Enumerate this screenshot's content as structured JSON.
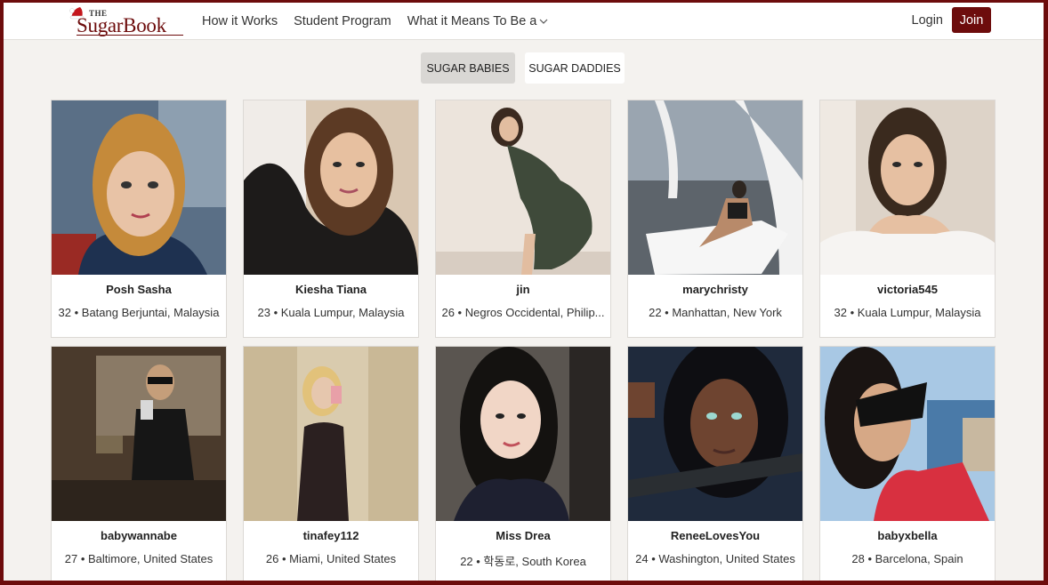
{
  "header": {
    "logo_top": "THE",
    "logo_word": "SugarBook",
    "nav": [
      "How it Works",
      "Student Program",
      "What it Means To Be a"
    ],
    "login": "Login",
    "join": "Join"
  },
  "tabs": [
    "SUGAR BABIES",
    "SUGAR DADDIES"
  ],
  "profiles": [
    {
      "name": "Posh Sasha",
      "info": "32 • Batang Berjuntai, Malaysia"
    },
    {
      "name": "Kiesha Tiana",
      "info": "23 • Kuala Lumpur, Malaysia"
    },
    {
      "name": "jin",
      "info": "26 • Negros Occidental, Philip..."
    },
    {
      "name": "marychristy",
      "info": "22 • Manhattan, New York"
    },
    {
      "name": "victoria545",
      "info": "32 • Kuala Lumpur, Malaysia"
    },
    {
      "name": "babywannabe",
      "info": "27 • Baltimore, United States"
    },
    {
      "name": "tinafey112",
      "info": "26 • Miami, United States"
    },
    {
      "name": "Miss Drea",
      "info": "22 • 학동로, South Korea"
    },
    {
      "name": "ReneeLovesYou",
      "info": "24 • Washington, United States"
    },
    {
      "name": "babyxbella",
      "info": "28 • Barcelona, Spain"
    }
  ],
  "colors": {
    "brand": "#6d0c0c",
    "background": "#f4f2ef"
  }
}
